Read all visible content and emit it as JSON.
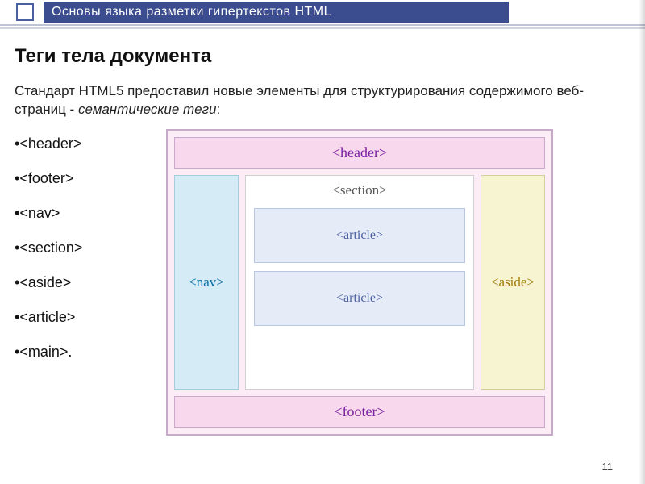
{
  "header": {
    "title": "Основы языка разметки гипертекстов HTML"
  },
  "slide": {
    "title": "Теги тела документа",
    "intro_plain": "Стандарт HTML5 предоставил новые элементы для структурирования содержимого веб-страниц - ",
    "intro_italic": "семантические теги",
    "intro_colon": ":"
  },
  "tags": [
    "<header>",
    "<footer>",
    "<nav>",
    "<section>",
    "<aside>",
    "<article>",
    "<main>."
  ],
  "diagram": {
    "header": "<header>",
    "nav": "<nav>",
    "section": "<section>",
    "article1": "<article>",
    "article2": "<article>",
    "aside": "<aside>",
    "footer": "<footer>"
  },
  "page_number": "11"
}
